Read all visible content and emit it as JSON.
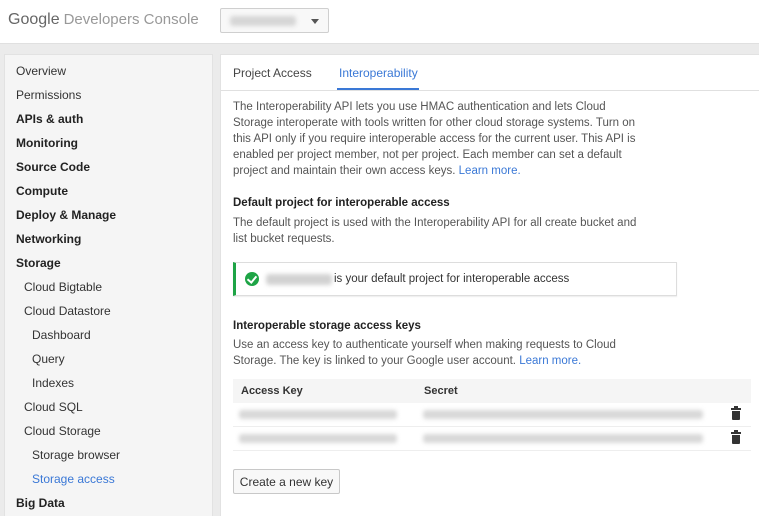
{
  "header": {
    "logo_google": "Google",
    "logo_product": "Developers Console"
  },
  "sidebar": {
    "items": [
      {
        "label": "Overview",
        "level": 0,
        "bold": false
      },
      {
        "label": "Permissions",
        "level": 0,
        "bold": false
      },
      {
        "label": "APIs & auth",
        "level": 0,
        "bold": true
      },
      {
        "label": "Monitoring",
        "level": 0,
        "bold": true
      },
      {
        "label": "Source Code",
        "level": 0,
        "bold": true
      },
      {
        "label": "Compute",
        "level": 0,
        "bold": true
      },
      {
        "label": "Deploy & Manage",
        "level": 0,
        "bold": true
      },
      {
        "label": "Networking",
        "level": 0,
        "bold": true
      },
      {
        "label": "Storage",
        "level": 0,
        "bold": true
      },
      {
        "label": "Cloud Bigtable",
        "level": 1,
        "bold": false
      },
      {
        "label": "Cloud Datastore",
        "level": 1,
        "bold": false
      },
      {
        "label": "Dashboard",
        "level": 2,
        "bold": false
      },
      {
        "label": "Query",
        "level": 2,
        "bold": false
      },
      {
        "label": "Indexes",
        "level": 2,
        "bold": false
      },
      {
        "label": "Cloud SQL",
        "level": 1,
        "bold": false
      },
      {
        "label": "Cloud Storage",
        "level": 1,
        "bold": false
      },
      {
        "label": "Storage browser",
        "level": 2,
        "bold": false
      },
      {
        "label": "Storage access",
        "level": 2,
        "bold": false,
        "active": true
      },
      {
        "label": "Big Data",
        "level": 0,
        "bold": true
      }
    ]
  },
  "tabs": [
    {
      "label": "Project Access",
      "active": false
    },
    {
      "label": "Interoperability",
      "active": true
    }
  ],
  "intro": {
    "lines": [
      "The Interoperability API lets you use HMAC authentication and lets Cloud",
      "Storage interoperate with tools written for other cloud storage systems. Turn on",
      "this API only if you require interoperable access for the current user. This API is",
      "enabled per project member, not per project. Each member can set a default"
    ],
    "last_line": "project and maintain their own access keys.",
    "link": "Learn more."
  },
  "default_project": {
    "heading": "Default project for interoperable access",
    "lines": [
      "The default project is used with the Interoperability API for all create bucket and",
      "list bucket requests."
    ],
    "notice_text": "is your default project for interoperable access"
  },
  "keys": {
    "heading": "Interoperable storage access keys",
    "line1": "Use an access key to authenticate yourself when making requests to Cloud",
    "line2": "Storage. The key is linked to your Google user account.",
    "link": "Learn more.",
    "columns": [
      "Access Key",
      "Secret"
    ],
    "create_button": "Create a new key"
  },
  "colors": {
    "accent": "#3a78d6",
    "success": "#1ea446"
  }
}
